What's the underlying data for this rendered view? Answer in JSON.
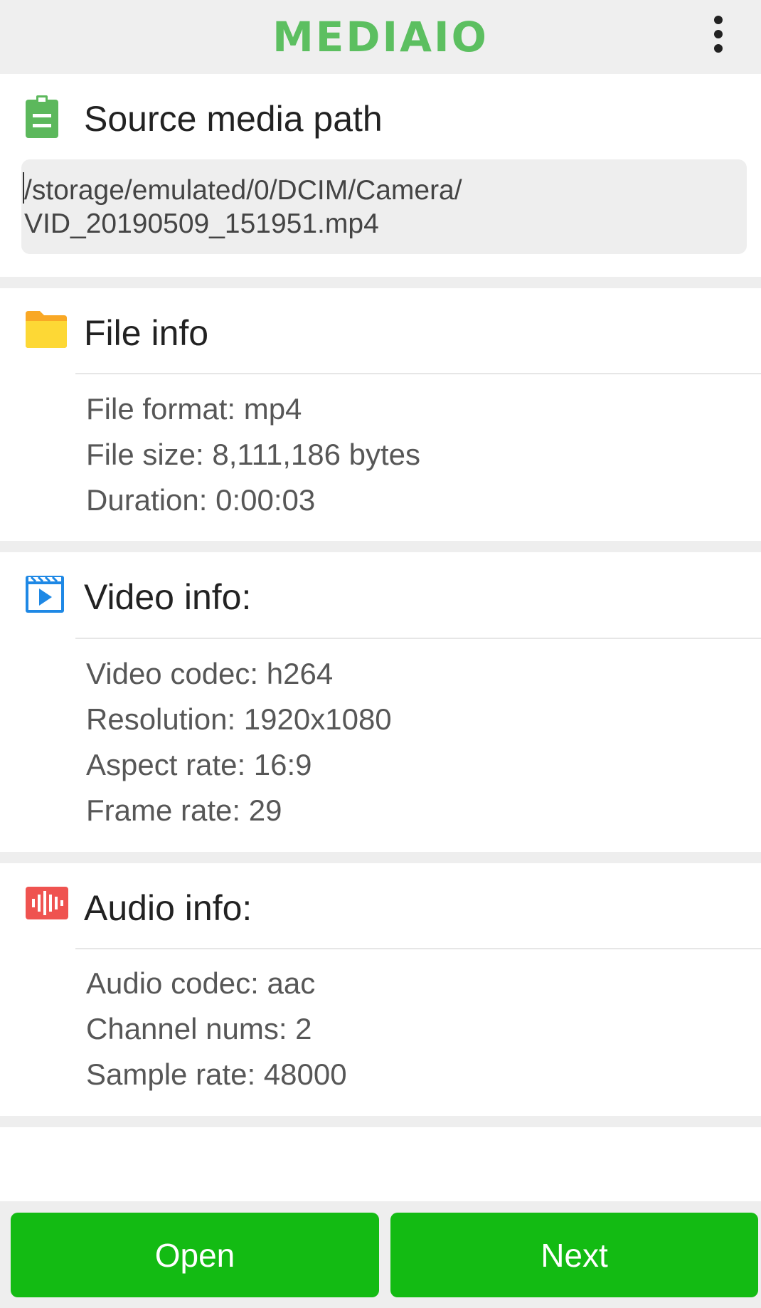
{
  "app": {
    "title": "MEDIAIO",
    "menu_icon": "more-vert-icon"
  },
  "source": {
    "title": "Source media path",
    "icon": "clipboard-icon",
    "icon_color": "#5cb85c",
    "path_line1": "/storage/emulated/0/DCIM/Camera/",
    "path_line2": "VID_20190509_151951.mp4"
  },
  "file_info": {
    "title": "File info",
    "icon": "folder-icon",
    "icon_color": "#fbc02d",
    "lines": [
      "File format: mp4",
      "File size: 8,111,186 bytes",
      "Duration: 0:00:03"
    ]
  },
  "video_info": {
    "title": "Video info:",
    "icon": "video-play-icon",
    "icon_color": "#1e88e5",
    "lines": [
      "Video codec: h264",
      "Resolution: 1920x1080",
      "Aspect rate: 16:9",
      "Frame rate: 29"
    ]
  },
  "audio_info": {
    "title": "Audio info:",
    "icon": "audio-wave-icon",
    "icon_color": "#ef5350",
    "lines": [
      "Audio codec: aac",
      "Channel nums: 2",
      "Sample rate: 48000"
    ]
  },
  "buttons": {
    "open_label": "Open",
    "next_label": "Next",
    "color": "#13bb13"
  }
}
